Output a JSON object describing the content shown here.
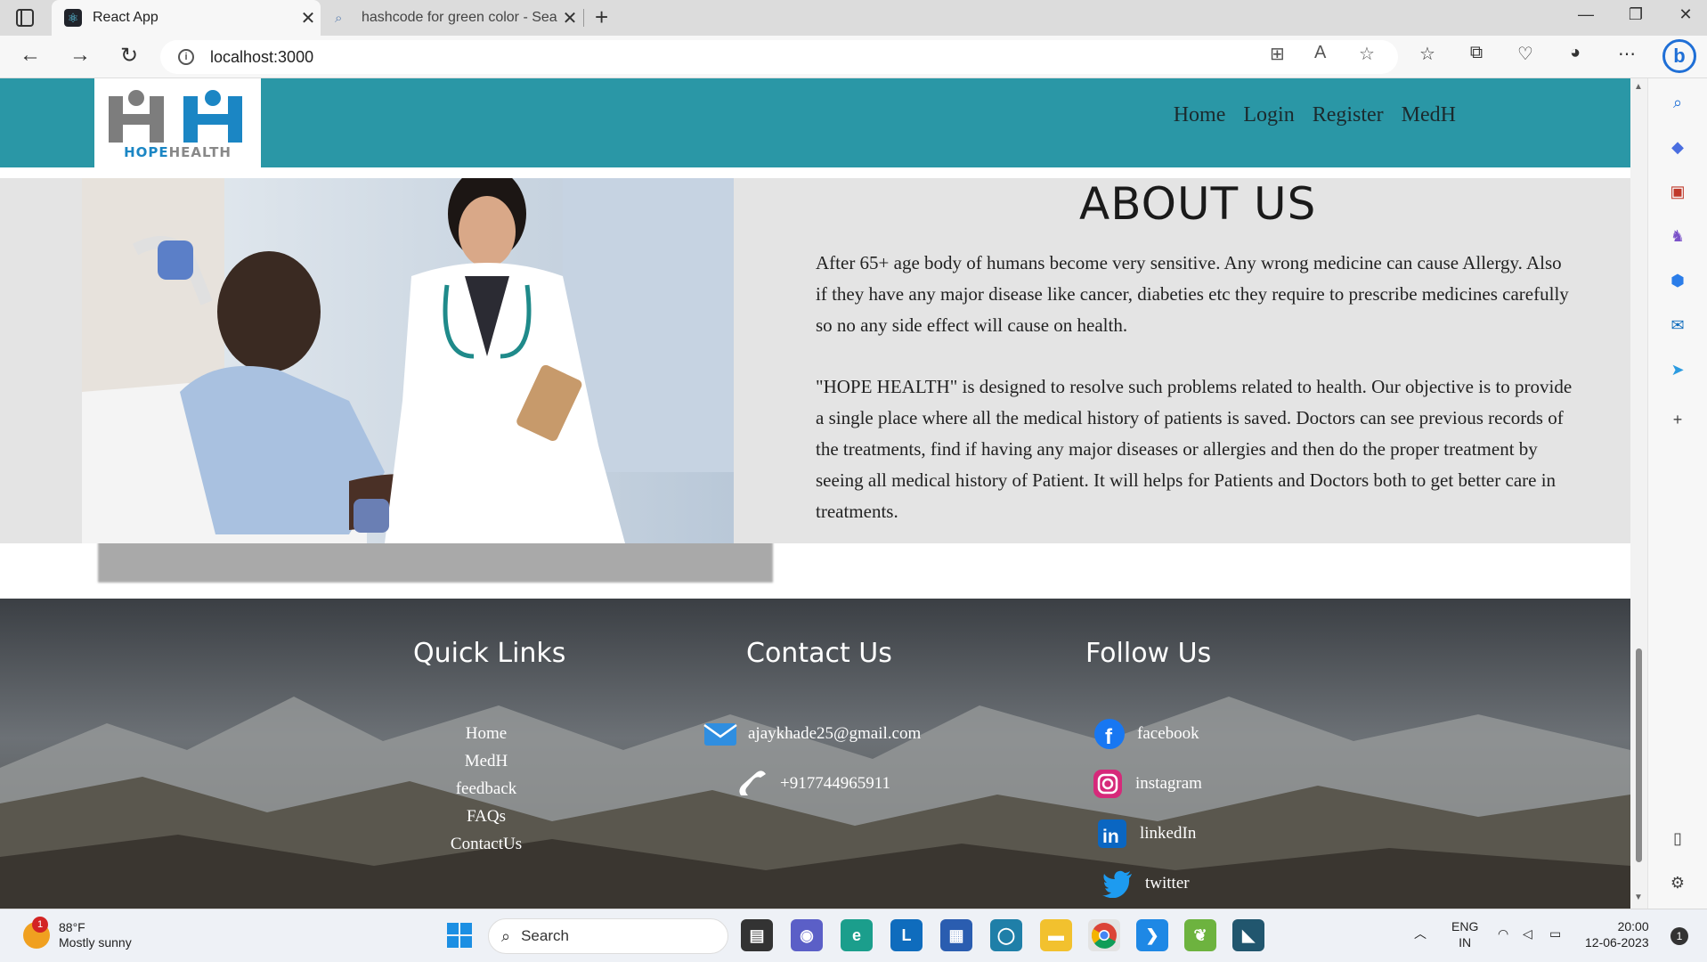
{
  "browser": {
    "tabs": [
      {
        "label": "React App",
        "active": true
      },
      {
        "label": "hashcode for green color - Searc",
        "active": false
      }
    ],
    "url": "localhost:3000"
  },
  "site": {
    "logo": {
      "part1": "HOPE",
      "part2": "HEALTH"
    },
    "nav": [
      "Home",
      "Login",
      "Register",
      "MedH"
    ],
    "about": {
      "title": "ABOUT US",
      "p1": "After 65+ age body of humans become very sensitive. Any wrong medicine can cause Allergy. Also if they have any major disease like cancer, diabeties etc they require to prescribe medicines carefully so no any side effect will cause on health.",
      "p2": "\"HOPE HEALTH\" is designed to resolve such problems related to health. Our objective is to provide a single place where all the medical history of patients is saved. Doctors can see previous records of the treatments, find if having any major diseases or allergies and then do the proper treatment by seeing all medical history of Patient. It will helps for Patients and Doctors both to get better care in treatments."
    },
    "footer": {
      "quick_links_title": "Quick Links",
      "quick_links": [
        "Home",
        "MedH",
        "feedback",
        "FAQs",
        "ContactUs"
      ],
      "contact_title": "Contact Us",
      "email": "ajaykhade25@gmail.com",
      "phone": "+917744965911",
      "follow_title": "Follow Us",
      "social": [
        "facebook",
        "instagram",
        "linkedIn",
        "twitter"
      ]
    }
  },
  "taskbar": {
    "weather_badge": "1",
    "temperature": "88°F",
    "condition": "Mostly sunny",
    "search_placeholder": "Search",
    "lang": "ENG",
    "region": "IN",
    "time": "20:00",
    "date": "12-06-2023",
    "notif_count": "1"
  },
  "colors": {
    "nav_bg": "#2a97a6",
    "about_bg": "#e4e4e4",
    "logo_blue": "#1b86c4"
  }
}
